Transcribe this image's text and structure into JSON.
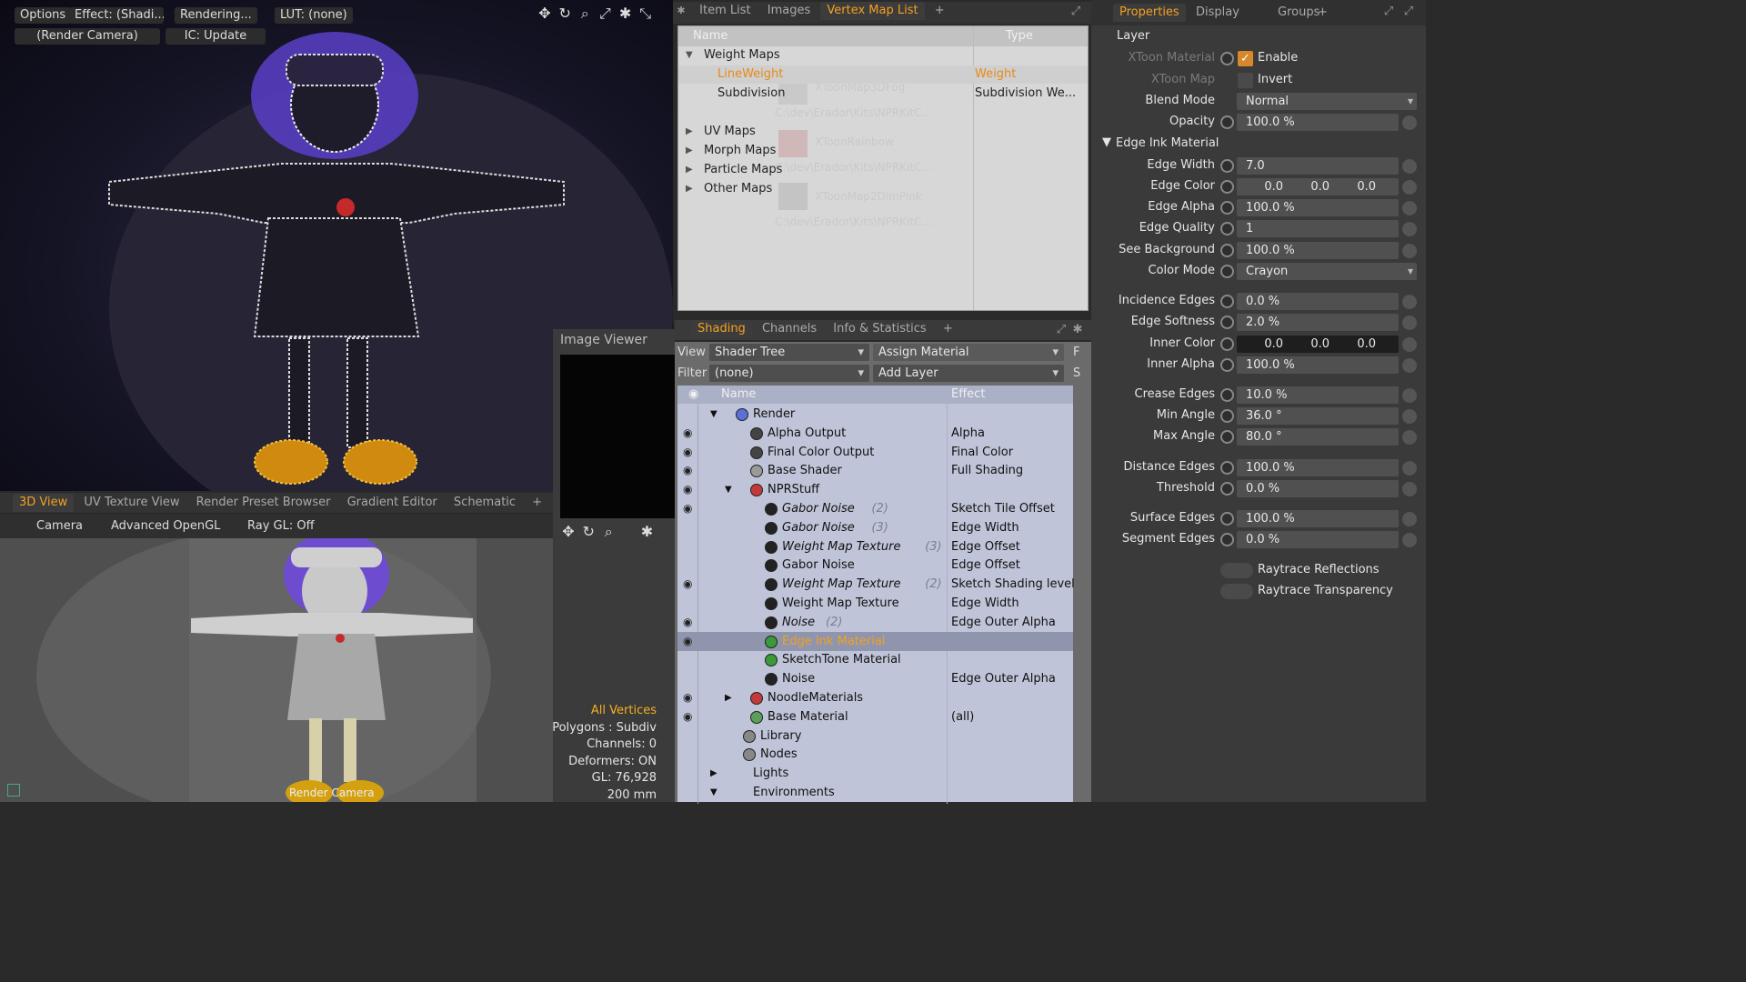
{
  "viewport_top": {
    "buttons": [
      "Options",
      "Effect: (Shadi...",
      "Rendering...",
      "LUT: (none)"
    ],
    "buttons2": [
      "(Render Camera)",
      "IC: Update"
    ]
  },
  "vmap_tabs": [
    "Item List",
    "Images",
    "Vertex Map List",
    "+"
  ],
  "vmap_active": "Vertex Map List",
  "vmap_header": {
    "name": "Name",
    "type": "Type"
  },
  "vmap_rows": [
    {
      "name": "Weight Maps",
      "type": "",
      "indent": 0,
      "arrow": "▼"
    },
    {
      "name": "LineWeight",
      "type": "Weight",
      "indent": 1,
      "arrow": "",
      "selected": true
    },
    {
      "name": "Subdivision",
      "type": "Subdivision We...",
      "indent": 1,
      "arrow": ""
    },
    {
      "name": "UV Maps",
      "type": "",
      "indent": 0,
      "arrow": "▶"
    },
    {
      "name": "Morph Maps",
      "type": "",
      "indent": 0,
      "arrow": "▶"
    },
    {
      "name": "Particle Maps",
      "type": "",
      "indent": 0,
      "arrow": "▶"
    },
    {
      "name": "Other Maps",
      "type": "",
      "indent": 0,
      "arrow": "▶"
    }
  ],
  "vmap_ghosts": [
    "XToonMap3DFog",
    "C:\\dev\\Erador\\Kits\\NPRKitC...",
    "XToonRainbow",
    "C:\\dev\\Erador\\Kits\\NPRKitC...",
    "XToonMap2DimPink",
    "C:\\dev\\Erador\\Kits\\NPRKitC..."
  ],
  "props": {
    "tabs": [
      "Properties",
      "Display",
      "Groups",
      "+"
    ],
    "active_tab": "Properties",
    "layer_label": "Layer",
    "xtoon_material": "XToon Material",
    "xtoon_map": "XToon Map",
    "enable": "Enable",
    "invert": "Invert",
    "blend_mode": {
      "label": "Blend Mode",
      "value": "Normal"
    },
    "opacity": {
      "label": "Opacity",
      "value": "100.0 %"
    },
    "section": "Edge Ink Material",
    "rows": [
      {
        "label": "Edge Width",
        "value": "7.0"
      },
      {
        "label": "Edge Color",
        "values": [
          "0.0",
          "0.0",
          "0.0"
        ]
      },
      {
        "label": "Edge Alpha",
        "value": "100.0 %"
      },
      {
        "label": "Edge Quality",
        "value": "1"
      },
      {
        "label": "See Background",
        "value": "100.0 %"
      },
      {
        "label": "Color Mode",
        "value": "Crayon",
        "dropdown": true
      },
      {
        "label": "Incidence Edges",
        "value": "0.0 %"
      },
      {
        "label": "Edge Softness",
        "value": "2.0 %"
      },
      {
        "label": "Inner Color",
        "values": [
          "0.0",
          "0.0",
          "0.0"
        ],
        "dark": true
      },
      {
        "label": "Inner Alpha",
        "value": "100.0 %"
      },
      {
        "label": "Crease Edges",
        "value": "10.0 %"
      },
      {
        "label": "Min Angle",
        "value": "36.0 °"
      },
      {
        "label": "Max Angle",
        "value": "80.0 °"
      },
      {
        "label": "Distance Edges",
        "value": "100.0 %"
      },
      {
        "label": "Threshold",
        "value": "0.0 %"
      },
      {
        "label": "Surface Edges",
        "value": "100.0 %"
      },
      {
        "label": "Segment Edges",
        "value": "0.0 %"
      }
    ],
    "raytrace_reflections": "Raytrace Reflections",
    "raytrace_transparency": "Raytrace Transparency"
  },
  "shading_tabs": [
    "Shading",
    "Channels",
    "Info & Statistics",
    "+"
  ],
  "shading_active": "Shading",
  "shading": {
    "view_label": "View",
    "view_value": "Shader Tree",
    "assign_material": "Assign Material",
    "filter_label": "Filter",
    "filter_value": "(none)",
    "add_layer": "Add Layer",
    "f_btn": "F",
    "s_btn": "S",
    "col_name": "Name",
    "col_effect": "Effect"
  },
  "tree": [
    {
      "name": "Render",
      "effect": "",
      "indent": 0,
      "icon": "#5b6fd6",
      "eye": false,
      "exp": "▼"
    },
    {
      "name": "Alpha Output",
      "effect": "Alpha",
      "indent": 1,
      "icon": "#444",
      "eye": true,
      "exp": ""
    },
    {
      "name": "Final Color Output",
      "effect": "Final Color",
      "indent": 1,
      "icon": "#444",
      "eye": true,
      "exp": ""
    },
    {
      "name": "Base Shader",
      "effect": "Full Shading",
      "indent": 1,
      "icon": "#9a9a9a",
      "eye": true,
      "exp": ""
    },
    {
      "name": "NPRStuff",
      "effect": "",
      "indent": 1,
      "icon": "#c43a3a",
      "eye": true,
      "exp": "▼"
    },
    {
      "name": "Gabor Noise",
      "tag": "(2)",
      "effect": "Sketch Tile Offset",
      "indent": 2,
      "icon": "#222",
      "eye": true,
      "italic": true
    },
    {
      "name": "Gabor Noise",
      "tag": "(3)",
      "effect": "Edge Width",
      "indent": 2,
      "icon": "#222",
      "eye": false,
      "italic": true
    },
    {
      "name": "Weight Map Texture",
      "tag": "(3)",
      "effect": "Edge Offset",
      "indent": 2,
      "icon": "#222",
      "eye": false,
      "italic": true
    },
    {
      "name": "Gabor Noise",
      "effect": "Edge Offset",
      "indent": 2,
      "icon": "#222",
      "eye": false
    },
    {
      "name": "Weight Map Texture",
      "tag": "(2)",
      "effect": "Sketch Shading level",
      "indent": 2,
      "icon": "#222",
      "eye": true,
      "italic": true
    },
    {
      "name": "Weight Map Texture",
      "effect": "Edge Width",
      "indent": 2,
      "icon": "#222",
      "eye": false
    },
    {
      "name": "Noise",
      "tag": "(2)",
      "effect": "Edge Outer Alpha",
      "indent": 2,
      "icon": "#222",
      "eye": true,
      "italic": true
    },
    {
      "name": "Edge Ink Material",
      "effect": "",
      "indent": 2,
      "icon": "#3a9a3a",
      "eye": true,
      "selected": true
    },
    {
      "name": "SketchTone Material",
      "effect": "",
      "indent": 2,
      "icon": "#3a9a3a",
      "eye": false
    },
    {
      "name": "Noise",
      "effect": "Edge Outer Alpha",
      "indent": 2,
      "icon": "#222",
      "eye": false
    },
    {
      "name": "NoodleMaterials",
      "effect": "",
      "indent": 1,
      "icon": "#c43a3a",
      "eye": true,
      "exp": "▶"
    },
    {
      "name": "Base Material",
      "effect": "(all)",
      "indent": 1,
      "icon": "#5aa05a",
      "eye": true
    },
    {
      "name": "Library",
      "effect": "",
      "indent": 0.5,
      "icon": "#888",
      "eye": false
    },
    {
      "name": "Nodes",
      "effect": "",
      "indent": 0.5,
      "icon": "#888",
      "eye": false
    },
    {
      "name": "Lights",
      "effect": "",
      "indent": 0,
      "icon": "",
      "eye": false,
      "exp": "▶"
    },
    {
      "name": "Environments",
      "effect": "",
      "indent": 0,
      "icon": "",
      "eye": false,
      "exp": "▼"
    }
  ],
  "lower_tabs": [
    "3D View",
    "UV Texture View",
    "Render Preset Browser",
    "Gradient Editor",
    "Schematic",
    "+"
  ],
  "lower_active": "3D View",
  "lower_toolbar": [
    "Camera",
    "Advanced OpenGL",
    "Ray GL: Off"
  ],
  "render_camera_label": "Render Camera",
  "image_viewer_title": "Image Viewer",
  "stats": [
    {
      "text": "All Vertices",
      "highlight": true
    },
    {
      "text": "Polygons : Subdiv"
    },
    {
      "text": "Channels: 0"
    },
    {
      "text": "Deformers: ON"
    },
    {
      "text": "GL: 76,928"
    },
    {
      "text": "200 mm"
    }
  ],
  "colors": {
    "accent": "#f4a020",
    "selected_row": "#8e95ad",
    "tree_bg": "#bfc4d8"
  }
}
